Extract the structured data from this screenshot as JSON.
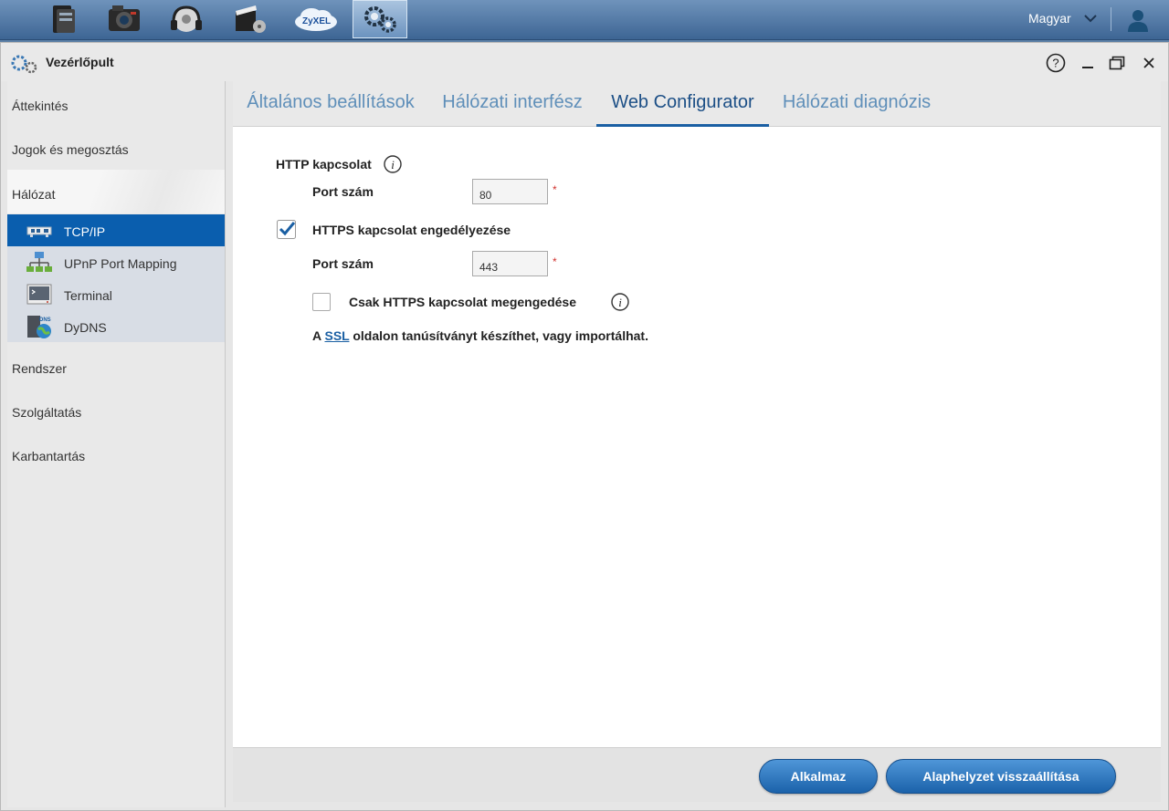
{
  "taskbar": {
    "apps": [
      "file-browser-icon",
      "photo-icon",
      "music-icon",
      "video-icon",
      "zyxel-cloud-icon",
      "control-panel-icon"
    ],
    "zyxel_logo_text": "ZyXEL",
    "language": "Magyar"
  },
  "window": {
    "title": "Vezérlőpult"
  },
  "sidebar": {
    "items": [
      {
        "label": "Áttekintés"
      },
      {
        "label": "Jogok és megosztás"
      },
      {
        "label": "Hálózat"
      },
      {
        "label": "Rendszer"
      },
      {
        "label": "Szolgáltatás"
      },
      {
        "label": "Karbantartás"
      }
    ],
    "network_sub": [
      {
        "label": "TCP/IP",
        "selected": true
      },
      {
        "label": "UPnP Port Mapping"
      },
      {
        "label": "Terminal"
      },
      {
        "label": "DyDNS"
      }
    ]
  },
  "tabs": [
    {
      "label": "Általános beállítások"
    },
    {
      "label": "Hálózati interfész"
    },
    {
      "label": "Web Configurator",
      "active": true
    },
    {
      "label": "Hálózati diagnózis"
    }
  ],
  "form": {
    "http_label": "HTTP kapcsolat",
    "port_label": "Port szám",
    "http_port": "80",
    "required_mark": "*",
    "https_enable_label": "HTTPS kapcsolat engedélyezése",
    "https_enabled": true,
    "https_port": "443",
    "https_only_label": "Csak HTTPS kapcsolat megengedése",
    "https_only": false,
    "note_prefix": "A",
    "note_link": "SSL",
    "note_suffix": "oldalon tanúsítványt készíthet, vagy importálhat."
  },
  "footer": {
    "apply_label": "Alkalmaz",
    "reset_label": "Alaphelyzet visszaállítása"
  },
  "colors": {
    "accent": "#1a5fa3",
    "selected_bg": "#0a5eae",
    "tab_inactive": "#5f8fb9"
  }
}
